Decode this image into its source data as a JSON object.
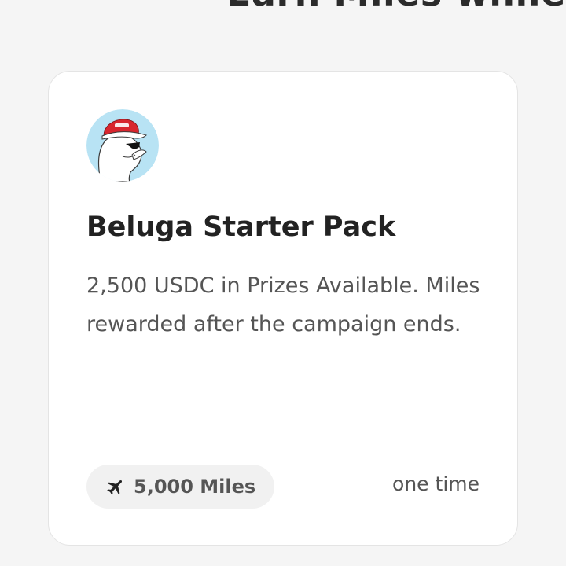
{
  "page": {
    "top_heading": "Earn Miles while in"
  },
  "card": {
    "avatar_icon": "beluga-avatar-icon",
    "title": "Beluga Starter Pack",
    "description": "2,500 USDC in Prizes Available. Miles rewarded after the campaign ends.",
    "reward": {
      "icon": "airplane-icon",
      "miles_label": "5,000 Miles"
    },
    "frequency": "one time"
  },
  "colors": {
    "background": "#f5f5f5",
    "card": "#ffffff",
    "pill": "#f1f1f1",
    "avatar_bg": "#b8e3f4",
    "cap_red": "#d8262e"
  }
}
